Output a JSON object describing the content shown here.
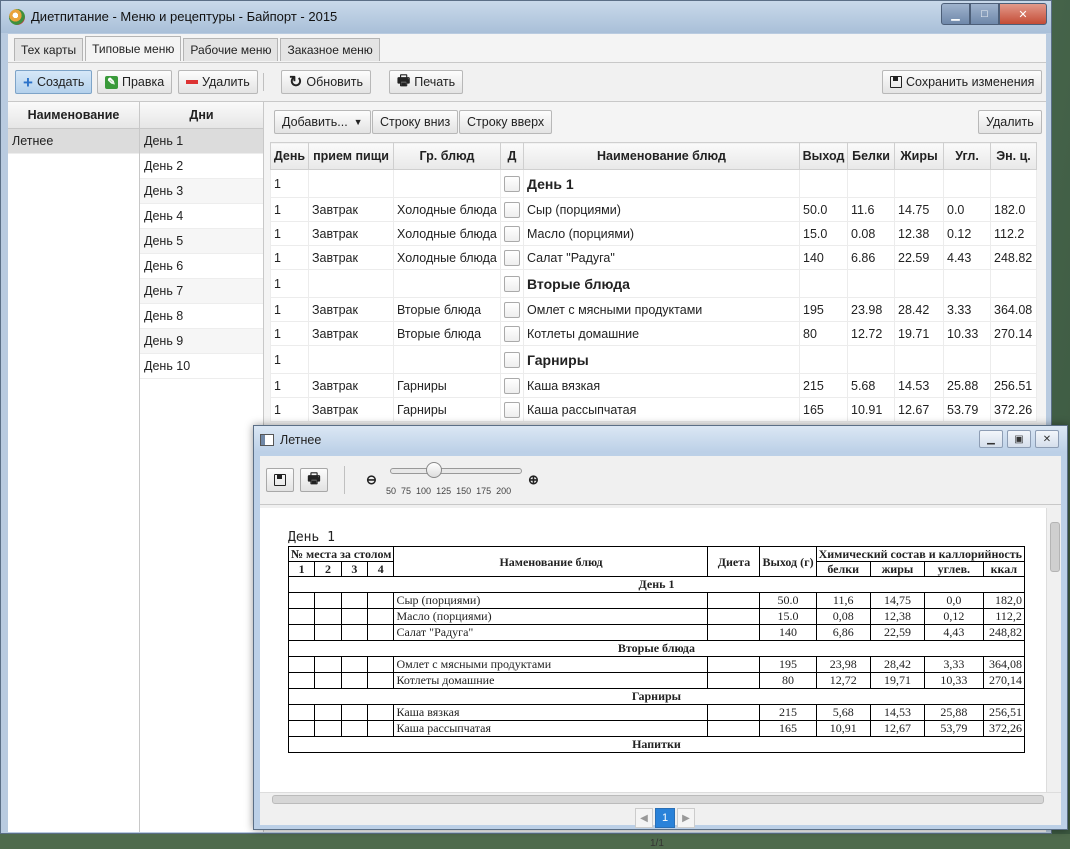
{
  "window": {
    "title": "Диетпитание - Меню и рецептуры - Байпорт - 2015"
  },
  "tabs": [
    "Тех карты",
    "Типовые меню",
    "Рабочие меню",
    "Заказное меню"
  ],
  "toolbar": {
    "create": "Создать",
    "edit": "Правка",
    "delete": "Удалить",
    "refresh": "Обновить",
    "print": "Печать",
    "save": "Сохранить изменения"
  },
  "menus": {
    "header": "Наименование",
    "items": [
      "Летнее"
    ]
  },
  "days": {
    "header": "Дни",
    "items": [
      "День 1",
      "День 2",
      "День 3",
      "День 4",
      "День 5",
      "День 6",
      "День 7",
      "День 8",
      "День 9",
      "День 10"
    ]
  },
  "detail": {
    "add": "Добавить...",
    "row_down": "Строку вниз",
    "row_up": "Строку вверх",
    "delete": "Удалить",
    "columns": [
      "День",
      "прием пищи",
      "Гр. блюд",
      "Д",
      "Наименование блюд",
      "Выход",
      "Белки",
      "Жиры",
      "Угл.",
      "Эн. ц."
    ],
    "rows": [
      {
        "group": true,
        "day": "1",
        "name": "День 1"
      },
      {
        "day": "1",
        "meal": "Завтрак",
        "grp": "Холодные блюда",
        "name": "Сыр (порциями)",
        "out": "50.0",
        "p": "11.6",
        "f": "14.75",
        "c": "0.0",
        "e": "182.0"
      },
      {
        "day": "1",
        "meal": "Завтрак",
        "grp": "Холодные блюда",
        "name": "Масло (порциями)",
        "out": "15.0",
        "p": "0.08",
        "f": "12.38",
        "c": "0.12",
        "e": "112.2"
      },
      {
        "day": "1",
        "meal": "Завтрак",
        "grp": "Холодные блюда",
        "name": "Салат \"Радуга\"",
        "out": "140",
        "p": "6.86",
        "f": "22.59",
        "c": "4.43",
        "e": "248.82"
      },
      {
        "group": true,
        "day": "1",
        "name": "Вторые блюда"
      },
      {
        "day": "1",
        "meal": "Завтрак",
        "grp": "Вторые блюда",
        "name": "Омлет с мясными продуктами",
        "out": "195",
        "p": "23.98",
        "f": "28.42",
        "c": "3.33",
        "e": "364.08"
      },
      {
        "day": "1",
        "meal": "Завтрак",
        "grp": "Вторые блюда",
        "name": "Котлеты домашние",
        "out": "80",
        "p": "12.72",
        "f": "19.71",
        "c": "10.33",
        "e": "270.14"
      },
      {
        "group": true,
        "day": "1",
        "name": "Гарниры"
      },
      {
        "day": "1",
        "meal": "Завтрак",
        "grp": "Гарниры",
        "name": "Каша вязкая",
        "out": "215",
        "p": "5.68",
        "f": "14.53",
        "c": "25.88",
        "e": "256.51"
      },
      {
        "day": "1",
        "meal": "Завтрак",
        "grp": "Гарниры",
        "name": "Каша рассыпчатая",
        "out": "165",
        "p": "10.91",
        "f": "12.67",
        "c": "53.79",
        "e": "372.26"
      }
    ]
  },
  "report": {
    "title": "Летнее",
    "zoom_ticks": [
      "50",
      "75",
      "100",
      "125",
      "150",
      "175",
      "200"
    ],
    "zoom_value": 100,
    "day_label": "День 1",
    "headers": {
      "seat": "№ места за столом",
      "seat_nums": [
        "1",
        "2",
        "3",
        "4"
      ],
      "name": "Наменование блюд",
      "diet": "Диета",
      "out": "Выход (г)",
      "chem": "Химический состав и каллорийность",
      "sub": [
        "белки",
        "жиры",
        "углев.",
        "ккал"
      ]
    },
    "rows": [
      {
        "group": "День 1"
      },
      {
        "name": "Сыр (порциями)",
        "out": "50.0",
        "p": "11,6",
        "f": "14,75",
        "c": "0,0",
        "e": "182,0"
      },
      {
        "name": "Масло (порциями)",
        "out": "15.0",
        "p": "0,08",
        "f": "12,38",
        "c": "0,12",
        "e": "112,2"
      },
      {
        "name": "Салат \"Радуга\"",
        "out": "140",
        "p": "6,86",
        "f": "22,59",
        "c": "4,43",
        "e": "248,82"
      },
      {
        "group": "Вторые блюда"
      },
      {
        "name": "Омлет с мясными продуктами",
        "out": "195",
        "p": "23,98",
        "f": "28,42",
        "c": "3,33",
        "e": "364,08"
      },
      {
        "name": "Котлеты домашние",
        "out": "80",
        "p": "12,72",
        "f": "19,71",
        "c": "10,33",
        "e": "270,14"
      },
      {
        "group": "Гарниры"
      },
      {
        "name": "Каша вязкая",
        "out": "215",
        "p": "5,68",
        "f": "14,53",
        "c": "25,88",
        "e": "256,51"
      },
      {
        "name": "Каша рассыпчатая",
        "out": "165",
        "p": "10,91",
        "f": "12,67",
        "c": "53,79",
        "e": "372,26"
      },
      {
        "group": "Напитки"
      }
    ],
    "page_current": "1",
    "page_count": "1/1"
  }
}
